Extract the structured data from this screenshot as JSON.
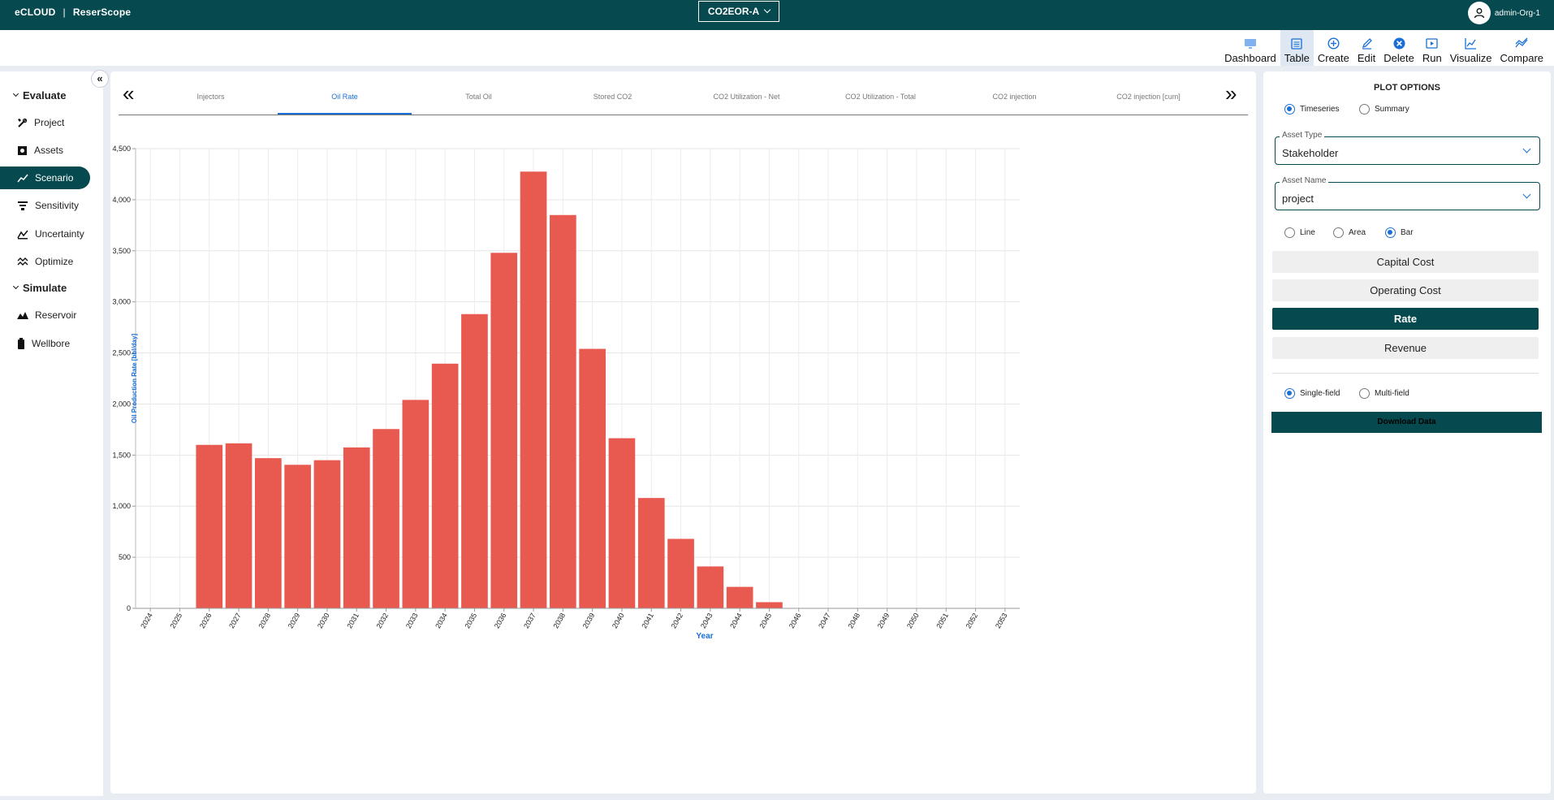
{
  "header": {
    "brand": "eCLOUD",
    "separator": "|",
    "product": "ReserScope",
    "project": "CO2EOR-A",
    "user": "admin-Org-1"
  },
  "toolbar": {
    "dashboard": "Dashboard",
    "table": "Table",
    "create": "Create",
    "edit": "Edit",
    "delete": "Delete",
    "run": "Run",
    "visualize": "Visualize",
    "compare": "Compare"
  },
  "sidebar": {
    "collapse": "«",
    "evaluate": "Evaluate",
    "simulate": "Simulate",
    "items": [
      "Project",
      "Assets",
      "Scenario",
      "Sensitivity",
      "Uncertainty",
      "Optimize",
      "Reservoir",
      "Wellbore"
    ]
  },
  "tabs": {
    "prev": "«",
    "next": "»",
    "items": [
      "Injectors",
      "Oil Rate",
      "Total Oil",
      "Stored CO2",
      "CO2 Utilization - Net",
      "CO2 Utilization - Total",
      "CO2 injection",
      "CO2 injection [cum]"
    ],
    "active": "Oil Rate"
  },
  "panel": {
    "title": "PLOT OPTIONS",
    "timeseries": "Timeseries",
    "summary": "Summary",
    "asset_type_label": "Asset Type",
    "asset_type_value": "Stakeholder",
    "asset_name_label": "Asset Name",
    "asset_name_value": "project",
    "line": "Line",
    "area": "Area",
    "bar": "Bar",
    "buttons": [
      "Capital Cost",
      "Operating Cost",
      "Rate",
      "Revenue"
    ],
    "active_button": "Rate",
    "single_field": "Single-field",
    "multi_field": "Multi-field",
    "download": "Download Data"
  },
  "colors": {
    "brand": "#06494f",
    "bar": "#e85a4f",
    "accent": "#1a6fd6"
  },
  "chart_data": {
    "type": "bar",
    "categories": [
      "2024",
      "2025",
      "2026",
      "2027",
      "2028",
      "2029",
      "2030",
      "2031",
      "2032",
      "2033",
      "2034",
      "2035",
      "2036",
      "2037",
      "2038",
      "2039",
      "2040",
      "2041",
      "2042",
      "2043",
      "2044",
      "2045",
      "2046",
      "2047",
      "2048",
      "2049",
      "2050",
      "2051",
      "2052",
      "2053"
    ],
    "values": [
      0,
      0,
      1600,
      1615,
      1470,
      1405,
      1450,
      1575,
      1755,
      2040,
      2395,
      2880,
      3480,
      4275,
      3850,
      2540,
      1665,
      1080,
      680,
      410,
      210,
      60,
      0,
      0,
      0,
      0,
      0,
      0,
      0,
      0
    ],
    "ylabel": "Oil Production Rate [bbl/day]",
    "xlabel": "Year",
    "ylim": [
      0,
      4500
    ],
    "yticks": [
      "0",
      "500",
      "1,000",
      "1,500",
      "2,000",
      "2,500",
      "3,000",
      "3,500",
      "4,000",
      "4,500"
    ],
    "grid": true
  }
}
